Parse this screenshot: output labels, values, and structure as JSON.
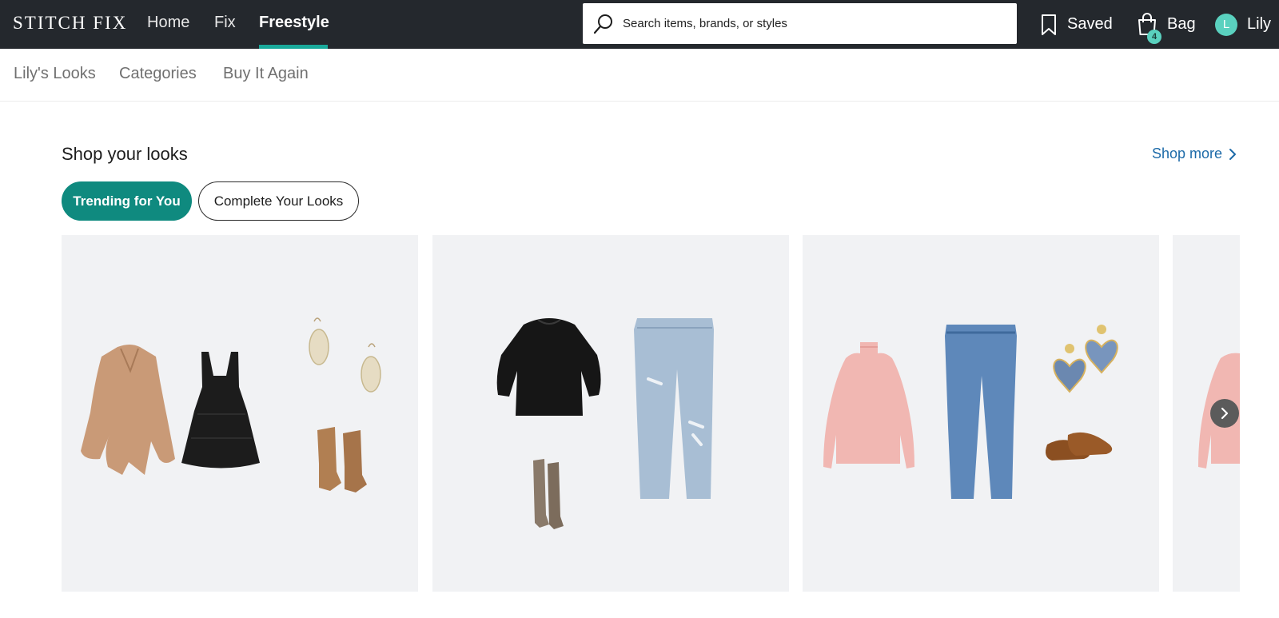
{
  "header": {
    "logo": "STITCH FIX",
    "nav": {
      "home": "Home",
      "fix": "Fix",
      "freestyle": "Freestyle"
    },
    "search": {
      "placeholder": "Search items, brands, or styles"
    },
    "saved_label": "Saved",
    "bag": {
      "label": "Bag",
      "count": "4"
    },
    "user": {
      "initial": "L",
      "name": "Lily"
    }
  },
  "subnav": {
    "looks": "Lily's Looks",
    "categories": "Categories",
    "buy_again": "Buy It Again"
  },
  "section": {
    "title": "Shop your looks",
    "shop_more": "Shop more",
    "tabs": {
      "trending": "Trending for You",
      "complete": "Complete Your Looks"
    }
  },
  "icons": {
    "search": "search-icon",
    "saved": "bookmark-icon",
    "bag": "shopping-bag-icon",
    "shop_more": "chevron-right-icon",
    "next": "chevron-right-icon"
  },
  "looks": [
    {
      "items": [
        "tan-cardigan-wrap",
        "black-tiered-dress",
        "gold-drop-earrings",
        "tan-slouch-boots"
      ]
    },
    {
      "items": [
        "black-puff-sleeve-top",
        "distressed-light-jeans",
        "taupe-knee-boots"
      ]
    },
    {
      "items": [
        "pink-turtleneck-sweater",
        "medium-wash-jeans",
        "beaded-heart-earrings",
        "velvet-loafers"
      ]
    },
    {
      "items": [
        "pink-turtleneck-sweater"
      ]
    }
  ],
  "colors": {
    "topbar": "#24282d",
    "accent": "#0f8a7f",
    "underline": "#19a99a",
    "link": "#1c6aa8",
    "badge": "#5ad1bf",
    "card_bg": "#f1f2f4"
  }
}
